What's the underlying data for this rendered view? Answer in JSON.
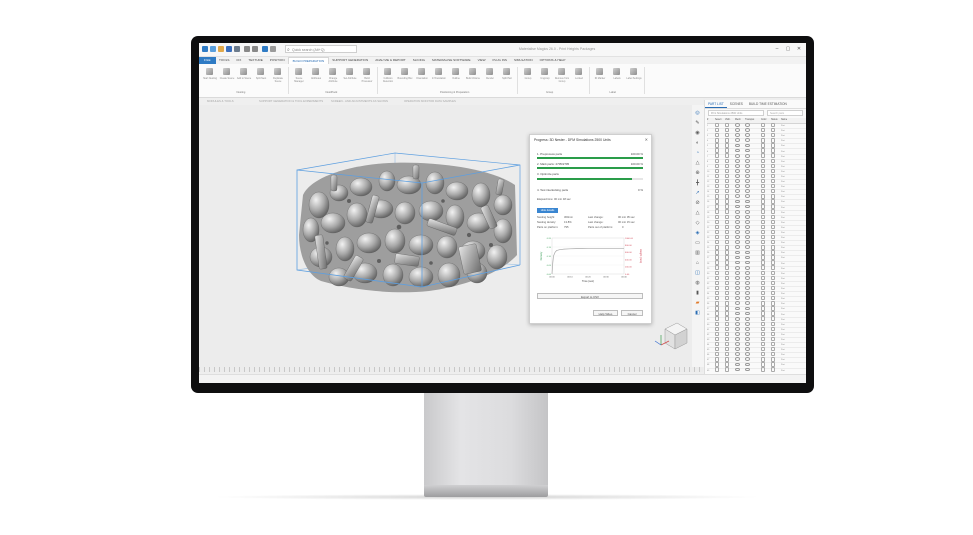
{
  "app": {
    "search_placeholder": "Quick search (Alt+Q)",
    "title": "Materialise Magics 26.0 - Print Heights Packages",
    "window_min": "–",
    "window_max": "▢",
    "window_close": "✕"
  },
  "ribbon": {
    "tabs": [
      "FILE",
      "TOOLS",
      "FIX",
      "TEXTURE",
      "POSITION",
      "BUILD PREPARATION",
      "SUPPORT GENERATION",
      "ANALYZE & REPORT",
      "SLICING",
      "MATERIALISE SOFTWARE",
      "VIEW",
      "PLUG INS",
      "SIMULATION",
      "OPTIONS & HELP"
    ],
    "active_tab": "BUILD PREPARATION",
    "groups": [
      {
        "label": "Nesting",
        "buttons": [
          "Start Nesting",
          "Create Scene",
          "Add to Scene",
          "Split Nest",
          "Duplicate Scene"
        ]
      },
      {
        "label": "Nest/Pack",
        "buttons": [
          "Scene Manager",
          "Attributes",
          "Change Attribute",
          "Set Attribute",
          "Build Processor"
        ]
      },
      {
        "label": "Positioning & Preparation",
        "buttons": [
          "Collision Detection",
          "Bounding Box",
          "Orientation",
          "Z-Translation",
          "Outline",
          "Build Volume",
          "Render",
          "Split Part"
        ]
      },
      {
        "label": "Group",
        "buttons": [
          "Group",
          "Ungroup",
          "Remove from Group",
          "Locked"
        ]
      },
      {
        "label": "Label",
        "buttons": [
          "ID Marker",
          "Labels",
          "Label Settings"
        ]
      }
    ]
  },
  "subbar": [
    "MODULES & TOOLS",
    "SUPPORT GENERATION & TOOL EXPERIMENTS",
    "SCREEN - AND ADJUSTMENTS AS SHOWN",
    "OPERATION MONITOR DATA SAMPLES"
  ],
  "panel": {
    "tabs": [
      "PART LIST",
      "SCENES",
      "BUILD TIME ESTIMATION"
    ],
    "active_tab": "PART LIST",
    "filter": "Print Simulations 2500 Units",
    "search_placeholder": "Search parts",
    "columns": [
      "#",
      "Select",
      "Visib.",
      "Mesh",
      "Transpar.",
      "Color",
      "Status",
      "Name"
    ],
    "row_count": 58,
    "row_name": "Part"
  },
  "dialog": {
    "title": "Progress: 3D Nester - DFM Simulations 2500 Units",
    "close": "✕",
    "steps": [
      {
        "label": "1. Preprocess parts",
        "pct": "100.00 %",
        "fill": 1.0
      },
      {
        "label": "2. Mark parts: 2705/2705",
        "pct": "100.00 %",
        "fill": 1.0
      },
      {
        "label": "3. Optimize parts",
        "pct": "",
        "fill": 0.9
      },
      {
        "label": "4. Test interlocking parts",
        "pct": "0 %",
        "fill": 0.0
      }
    ],
    "elapsed": "Elapsed time: 00 min 48 sec",
    "hide_label": "Hide details",
    "stats": {
      "nesting_height_label": "Nesting height:",
      "nesting_height": "300mm",
      "nesting_density_label": "Nesting density:",
      "nesting_density": "13.8%",
      "on_platform_label": "Parts on platform:",
      "on_platform": "795",
      "last_change1_label": "Last change:",
      "last_change1": "00 min 05 sec",
      "last_change2_label": "Last change:",
      "last_change2": "00 min 15 sec",
      "out_platform_label": "Parts out of platform:",
      "out_platform": "0"
    },
    "export_label": "Export to CSV",
    "help_label": "Help Video",
    "cancel_label": "Cancel"
  },
  "chart_data": {
    "type": "line",
    "xlabel": "Time (sec)",
    "ylabel": "Density",
    "ylabel_right": "Height (mm)",
    "x": [
      0,
      0.5,
      1,
      2,
      3,
      5,
      8,
      12,
      16,
      20,
      24,
      28,
      32,
      36,
      40,
      44,
      48
    ],
    "x_ticks": [
      "00:00",
      "00:10",
      "00:20",
      "00:30",
      "00:40"
    ],
    "y_ticks": [
      "0.00",
      "0.05",
      "0.10",
      "0.15",
      "0.20"
    ],
    "y2_ticks": [
      "0.00",
      "200.00",
      "400.00",
      "600.00",
      "800.00",
      "1000.00"
    ],
    "ylim": [
      0,
      0.2
    ],
    "series": [
      {
        "name": "Density",
        "values": [
          0.0,
          0.06,
          0.1,
          0.12,
          0.13,
          0.135,
          0.138,
          0.14,
          0.141,
          0.141,
          0.142,
          0.142,
          0.142,
          0.142,
          0.142,
          0.142,
          0.142
        ]
      }
    ]
  },
  "colors": {
    "file_tab": "#2f7bc4",
    "accent": "#2a6db4",
    "progress": "#2a9d4a",
    "density_line": "#3c9e5a",
    "height_axis": "#d24a5a",
    "curve": "#a9a9a9"
  }
}
